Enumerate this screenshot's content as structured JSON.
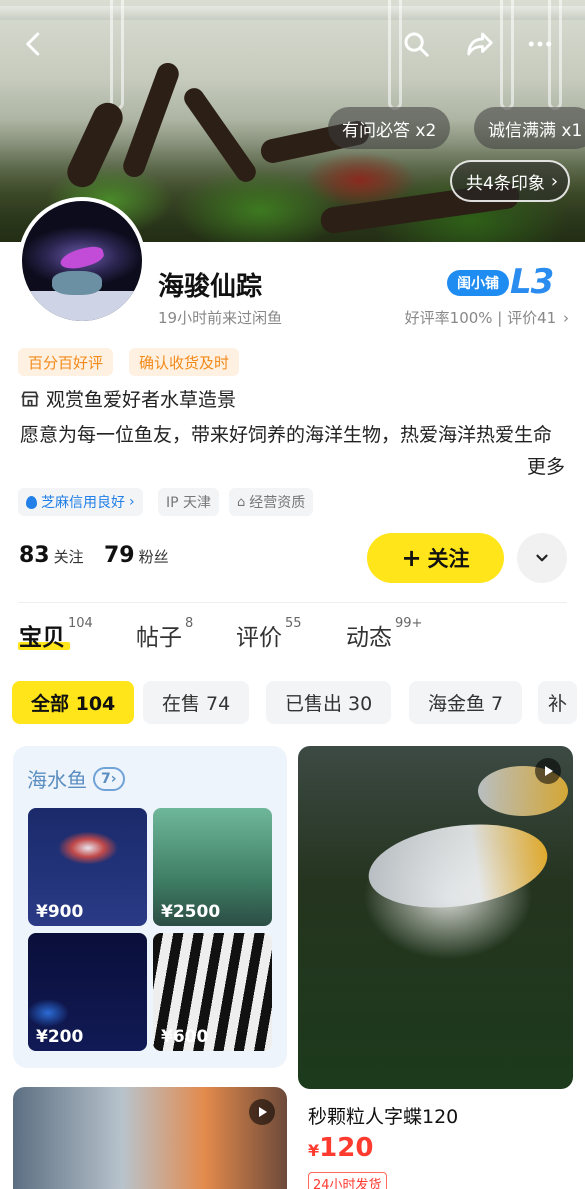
{
  "hero": {
    "chips": [
      {
        "label": "有问必答 x2"
      },
      {
        "label": "诚信满满 x1"
      }
    ],
    "impressions_label": "共4条印象",
    "icons": [
      "back-arrow-icon",
      "search-icon",
      "share-icon",
      "more-dots-icon"
    ]
  },
  "shop": {
    "name": "海骏仙踪",
    "last_seen": "19小时前来过闲鱼",
    "badge_label": "闺小铺",
    "level": "L3",
    "rating_line": "好评率100% | 评价41",
    "tags": [
      "百分百好评",
      "确认收货及时"
    ],
    "intro_title": "观赏鱼爱好者水草造景",
    "intro_body": "愿意为每一位鱼友，带来好饲养的海洋生物，热爱海洋热爱生命",
    "more_label": "更多",
    "credit_chips": [
      {
        "label": "芝麻信用良好",
        "icon": "sesame-drop-icon"
      },
      {
        "label": "IP 天津"
      },
      {
        "label": "经营资质",
        "icon": "store-icon"
      }
    ],
    "following_count": "83",
    "following_label": "关注",
    "followers_count": "79",
    "followers_label": "粉丝",
    "follow_button": "关注"
  },
  "tabs": [
    {
      "label": "宝贝",
      "count": "104",
      "active": true
    },
    {
      "label": "帖子",
      "count": "8"
    },
    {
      "label": "评价",
      "count": "55"
    },
    {
      "label": "动态",
      "count": "99+"
    }
  ],
  "filters": [
    {
      "label": "全部 104",
      "active": true
    },
    {
      "label": "在售 74"
    },
    {
      "label": "已售出 30"
    },
    {
      "label": "海金鱼 7"
    },
    {
      "label": "补"
    }
  ],
  "collection": {
    "title": "海水鱼",
    "count": "7",
    "items": [
      {
        "price": "¥900"
      },
      {
        "price": "¥2500"
      },
      {
        "price": "¥200"
      },
      {
        "price": "¥600"
      }
    ]
  },
  "product": {
    "title": "秒颗粒人字蝶120",
    "currency": "¥",
    "price": "120",
    "shipping_tag": "24小时发货"
  },
  "colors": {
    "accent_yellow": "#ffe519",
    "tag_orange": "#f28a1a",
    "price_red": "#ff3a2f",
    "brand_blue": "#2b8cf0"
  }
}
